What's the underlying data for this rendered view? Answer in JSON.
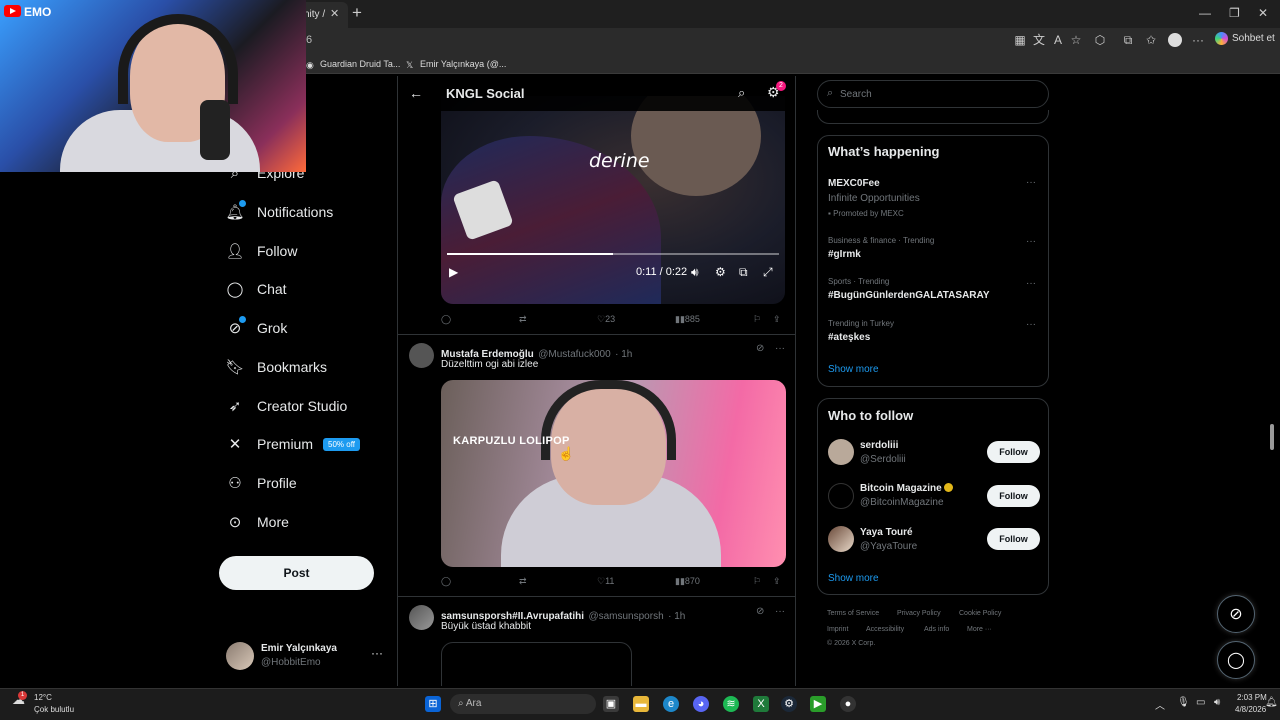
{
  "browser": {
    "active_tab_label": "nity /",
    "address_fragment": "6",
    "favorites": [
      {
        "label": "Guardian Druid Ta..."
      },
      {
        "label": "Emir Yalçınkaya (@..."
      }
    ],
    "copilot_label": "Sohbet et"
  },
  "webcam": {
    "channel_label": "EMO"
  },
  "nav": {
    "items": [
      {
        "label": "Explore",
        "icon": "search-icon"
      },
      {
        "label": "Notifications",
        "icon": "bell-icon"
      },
      {
        "label": "Follow",
        "icon": "add-person-icon"
      },
      {
        "label": "Chat",
        "icon": "chat-bubble-icon"
      },
      {
        "label": "Grok",
        "icon": "grok-icon"
      },
      {
        "label": "Bookmarks",
        "icon": "bookmark-icon"
      },
      {
        "label": "Creator Studio",
        "icon": "rocket-icon"
      },
      {
        "label": "Premium",
        "icon": "x-logo-icon",
        "badge": "50% off"
      },
      {
        "label": "Profile",
        "icon": "person-icon"
      },
      {
        "label": "More",
        "icon": "more-circle-icon"
      }
    ],
    "post_label": "Post",
    "account": {
      "name": "Emir Yalçınkaya",
      "handle": "@HobbitEmo"
    }
  },
  "main": {
    "title": "KNGL Social",
    "settings_badge": "2",
    "tweets": [
      {
        "video_caption": "derine",
        "time": "0:11 / 0:22",
        "progress": 0.5,
        "stats": {
          "replies": "",
          "reposts": "",
          "likes": "23",
          "views": "885"
        }
      },
      {
        "name": "Mustafa Erdemoğlu",
        "handle": "@Mustafuck000",
        "age": "· 1h",
        "text": "Düzelttim ogi abi izlee",
        "video_caption": "KARPUZLU LOLIPOP",
        "stats": {
          "replies": "",
          "reposts": "",
          "likes": "11",
          "views": "870"
        }
      },
      {
        "name": "samsunsporsh#II.Avrupafatihi",
        "handle": "@samsunsporsh",
        "age": "· 1h",
        "text": "Büyük üstad khabbit"
      }
    ]
  },
  "sidebar": {
    "search_placeholder": "Search",
    "trends_title": "What’s happening",
    "trends": [
      {
        "name": "MEXC0Fee",
        "meta": "Infinite Opportunities",
        "promo": "Promoted by MEXC"
      },
      {
        "meta": "Business & finance · Trending",
        "name": "#gIrmk"
      },
      {
        "meta": "Sports · Trending",
        "name": "#BugünGünlerdenGALATASARAY"
      },
      {
        "meta": "Trending in Turkey",
        "name": "#ateşkes"
      }
    ],
    "show_more": "Show more",
    "wtf_title": "Who to follow",
    "who_to_follow": [
      {
        "name": "serdoliii",
        "handle": "@Serdoliii",
        "follow_label": "Follow"
      },
      {
        "name": "Bitcoin Magazine",
        "handle": "@BitcoinMagazine",
        "follow_label": "Follow"
      },
      {
        "name": "Yaya Touré",
        "handle": "@YayaToure",
        "follow_label": "Follow"
      }
    ],
    "footer": {
      "links": [
        "Terms of Service",
        "Privacy Policy",
        "Cookie Policy",
        "Imprint",
        "Accessibility",
        "Ads info",
        "More ···"
      ],
      "copyright": "© 2026 X Corp."
    }
  },
  "taskbar": {
    "weather_temp": "12°C",
    "weather_desc": "Çok bulutlu",
    "search_label": "Ara",
    "time": "2:03 PM",
    "date": "4/8/2026"
  }
}
